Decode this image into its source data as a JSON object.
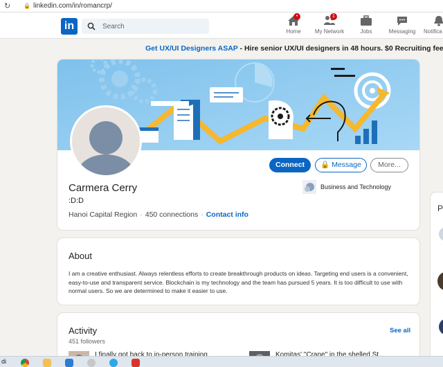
{
  "browser": {
    "url": "linkedin.com/in/romancrp/"
  },
  "nav": {
    "logo": "in",
    "search_placeholder": "Search",
    "items": [
      {
        "label": "Home",
        "icon": "home-icon",
        "badge": ""
      },
      {
        "label": "My Network",
        "icon": "network-icon",
        "badge": "1"
      },
      {
        "label": "Jobs",
        "icon": "briefcase-icon",
        "badge": ""
      },
      {
        "label": "Messaging",
        "icon": "chat-icon",
        "badge": ""
      },
      {
        "label": "Notifica",
        "icon": "bell-icon",
        "badge": ""
      }
    ]
  },
  "ad": {
    "link": "Get UX/UI Designers ASAP",
    "text": " - Hire senior UX/UI designers in 48 hours. $0 Recruiting fee. Star"
  },
  "profile": {
    "name": "Carmera Cerry",
    "headline": ":D:D",
    "location": "Hanoi Capital Region",
    "connections": "450 connections",
    "contact": "Contact info",
    "company": "Business and Technology",
    "buttons": {
      "connect": "Connect",
      "message": "Message",
      "more": "More..."
    }
  },
  "about": {
    "title": "About",
    "text": "I am a creative enthusiast. Always relentless efforts to create breakthrough products on ideas. Targeting end users is a convenient, easy-to-use and transparent service. Blockchain is my technology and the team has pursued 5 years. It is too difficult to use with normal users. So we are determined to make it easier to use."
  },
  "activity": {
    "title": "Activity",
    "followers": "451 followers",
    "see_all": "See all",
    "posts": [
      {
        "title": "I finally got back to in-person training"
      },
      {
        "title": "Komitas' \"Crane\" in the shelled St..."
      }
    ]
  },
  "right_peek": {
    "letter": "P"
  },
  "taskbar": {
    "left_text": "di"
  },
  "colors": {
    "brand": "#0a66c2",
    "badge": "#cc1016",
    "banner_bg": "#8fc9ef",
    "accent_yellow": "#f5b82e"
  }
}
